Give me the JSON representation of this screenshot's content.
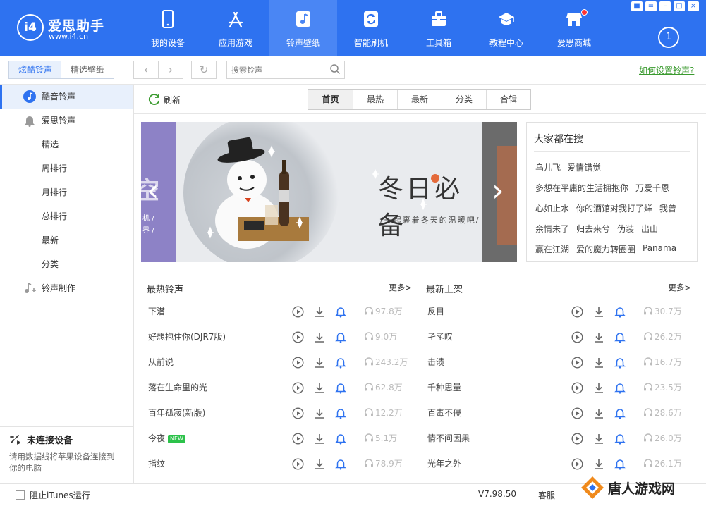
{
  "app": {
    "logo_badge": "i4",
    "name": "爱思助手",
    "url": "www.i4.cn"
  },
  "nav": [
    {
      "label": "我的设备",
      "icon": "phone-icon"
    },
    {
      "label": "应用游戏",
      "icon": "app-store-icon"
    },
    {
      "label": "铃声壁纸",
      "icon": "music-icon",
      "active": true
    },
    {
      "label": "智能刷机",
      "icon": "flash-icon"
    },
    {
      "label": "工具箱",
      "icon": "toolbox-icon"
    },
    {
      "label": "教程中心",
      "icon": "graduation-cap-icon"
    },
    {
      "label": "爱思商城",
      "icon": "shop-icon",
      "badge": true
    }
  ],
  "download_count": "1",
  "window_controls": [
    "shirt-icon",
    "menu-icon",
    "minimize-icon",
    "maximize-icon",
    "close-icon"
  ],
  "toolbar": {
    "segments": [
      "炫酷铃声",
      "精选壁纸"
    ],
    "search_placeholder": "搜索铃声",
    "help_link": "如何设置铃声?"
  },
  "sidebar": {
    "items": [
      {
        "label": "酷音铃声",
        "icon": "music-note-icon",
        "active": true
      },
      {
        "label": "爱思铃声",
        "icon": "bell-icon"
      },
      {
        "label": "精选"
      },
      {
        "label": "周排行"
      },
      {
        "label": "月排行"
      },
      {
        "label": "总排行"
      },
      {
        "label": "最新"
      },
      {
        "label": "分类"
      },
      {
        "label": "铃声制作",
        "icon": "music-add-icon"
      }
    ],
    "connection": {
      "title": "未连接设备",
      "desc": "请用数据线将苹果设备连接到你的电脑"
    }
  },
  "subbar": {
    "refresh": "刷新",
    "tabs": [
      "首页",
      "最热",
      "最新",
      "分类",
      "合辑"
    ],
    "active_tab": 0
  },
  "banner": {
    "title": "冬日必备",
    "subtitle": "/一起裹着冬天的温暖吧/",
    "left_peek": "空",
    "left_peek_lines": [
      "机 /",
      "界 /"
    ]
  },
  "hot_search": {
    "title": "大家都在搜",
    "rows": [
      [
        "乌儿飞",
        "爱情错觉"
      ],
      [
        "多想在平庸的生活拥抱你",
        "万爱千恩"
      ],
      [
        "心如止水",
        "你的酒馆对我打了烊",
        "我曾"
      ],
      [
        "余情未了",
        "归去来兮",
        "伪装",
        "出山"
      ],
      [
        "赢在江湖",
        "爱的魔力转圈圈",
        "Panama"
      ]
    ]
  },
  "lists": {
    "more": "更多>",
    "hot": {
      "title": "最热铃声",
      "rows": [
        {
          "name": "下潜",
          "count": "97.8万"
        },
        {
          "name": "好想抱住你(DJR7版)",
          "count": "9.0万"
        },
        {
          "name": "从前说",
          "count": "243.2万"
        },
        {
          "name": "落在生命里的光",
          "count": "62.8万"
        },
        {
          "name": "百年孤寂(新版)",
          "count": "12.2万"
        },
        {
          "name": "今夜",
          "count": "5.1万",
          "new": "NEW"
        },
        {
          "name": "指纹",
          "count": "78.9万"
        }
      ]
    },
    "latest": {
      "title": "最新上架",
      "rows": [
        {
          "name": "反目",
          "count": "30.7万"
        },
        {
          "name": "孑孓叹",
          "count": "26.2万"
        },
        {
          "name": "击溃",
          "count": "16.7万"
        },
        {
          "name": "千种思量",
          "count": "23.5万"
        },
        {
          "name": "百毒不侵",
          "count": "28.6万"
        },
        {
          "name": "情不问因果",
          "count": "26.0万"
        },
        {
          "name": "光年之外",
          "count": "26.1万"
        }
      ]
    }
  },
  "statusbar": {
    "itunes_label": "阻止iTunes运行",
    "version": "V7.98.50",
    "service": "客服"
  },
  "watermark": "唐人游戏网",
  "colors": {
    "brand": "#2e72f0",
    "accent_green": "#3a9a2e",
    "play_icon": "#666666",
    "bell_icon": "#2e72f0"
  }
}
